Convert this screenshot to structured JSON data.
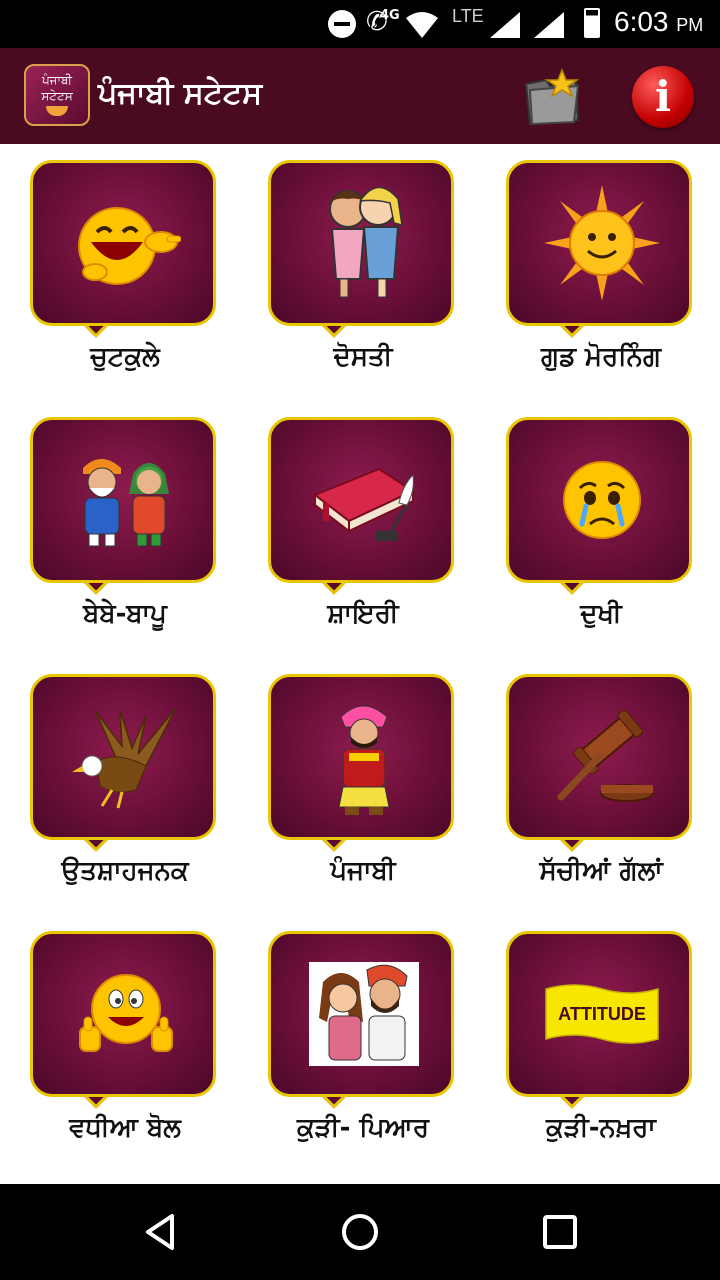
{
  "status_bar": {
    "network_4g": "4G",
    "network_lte": "LTE",
    "time": "6:03",
    "ampm": "PM",
    "icons": [
      "do-not-disturb-icon",
      "wifi-call-icon",
      "wifi-icon",
      "signal-icon",
      "signal-icon",
      "battery-icon"
    ]
  },
  "app_bar": {
    "logo_line1": "ਪੰਜਾਬੀ",
    "logo_line2": "ਸਟੇਟਸ",
    "title": "ਪੰਜਾਬੀ ਸਟੇਟਸ",
    "actions": [
      "favorites-folder-icon",
      "info-icon"
    ],
    "info_glyph": "i",
    "colors": {
      "background": "#4a0a20",
      "title": "#ffffff"
    }
  },
  "grid": {
    "colors": {
      "tile_border": "#e9c600",
      "tile_fill": "#6b0f39",
      "label": "#111111"
    },
    "tiles": [
      {
        "label": "ਚੁਟਕੁਲੇ",
        "icon": "laughing-emoji-icon"
      },
      {
        "label": "ਦੋਸਤੀ",
        "icon": "friends-hug-icon"
      },
      {
        "label": "ਗੁਡ ਮੋਰਨਿੰਗ",
        "icon": "sun-icon"
      },
      {
        "label": "ਬੇਬੇ-ਬਾਪੂ",
        "icon": "couple-icon"
      },
      {
        "label": "ਸ਼ਾਇਰੀ",
        "icon": "book-quill-icon"
      },
      {
        "label": "ਦੁਖੀ",
        "icon": "crying-emoji-icon"
      },
      {
        "label": "ਉਤਸ਼ਾਹਜਨਕ",
        "icon": "eagle-icon"
      },
      {
        "label": "ਪੰਜਾਬੀ",
        "icon": "punjabi-man-icon"
      },
      {
        "label": "ਸੱਚੀਆਂ ਗੱਲਾਂ",
        "icon": "gavel-icon"
      },
      {
        "label": "ਵਧੀਆ ਬੋਲ",
        "icon": "thumbs-up-emoji-icon"
      },
      {
        "label": "ਕੁੜੀ- ਪਿਆਰ",
        "icon": "love-couple-icon"
      },
      {
        "label": "ਕੁੜੀ-ਨਖ਼ਰਾ",
        "icon": "attitude-flag-icon",
        "icon_text": "ATTITUDE"
      }
    ]
  },
  "nav_bar": {
    "buttons": [
      "back-icon",
      "home-icon",
      "recent-apps-icon"
    ]
  }
}
